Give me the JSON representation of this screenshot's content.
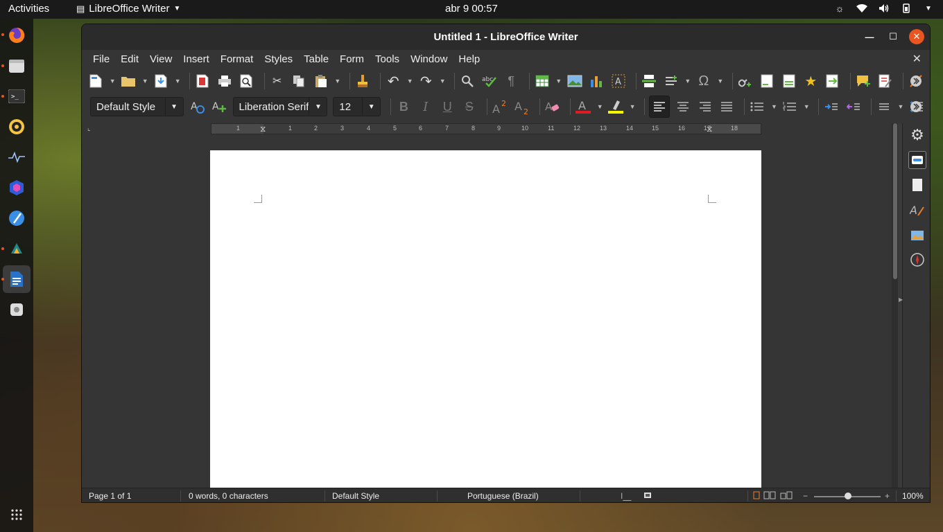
{
  "topbar": {
    "activities": "Activities",
    "app_name": "LibreOffice Writer",
    "clock": "abr 9  00:57"
  },
  "window": {
    "title": "Untitled 1 - LibreOffice Writer"
  },
  "menubar": {
    "items": [
      "File",
      "Edit",
      "View",
      "Insert",
      "Format",
      "Styles",
      "Table",
      "Form",
      "Tools",
      "Window",
      "Help"
    ]
  },
  "formatting": {
    "paragraph_style": "Default Style",
    "font_name": "Liberation Serif",
    "font_size": "12"
  },
  "ruler": {
    "numbers": [
      "1",
      "1",
      "2",
      "3",
      "4",
      "5",
      "6",
      "7",
      "8",
      "9",
      "10",
      "11",
      "12",
      "13",
      "14",
      "15",
      "16",
      "17",
      "18"
    ]
  },
  "statusbar": {
    "page": "Page 1 of 1",
    "words": "0 words, 0 characters",
    "page_style": "Default Style",
    "language": "Portuguese (Brazil)",
    "zoom": "100%"
  },
  "colors": {
    "accent": "#e95420",
    "font_color": "#e01b24",
    "highlight_color": "#f6f600"
  },
  "dock": {
    "apps": [
      "firefox-icon",
      "files-icon",
      "terminal-icon",
      "rhythmbox-icon",
      "system-monitor-icon",
      "cube-app-icon",
      "text-editor-icon",
      "sublime-icon",
      "libreoffice-writer-icon",
      "software-icon",
      "show-apps-icon"
    ]
  }
}
